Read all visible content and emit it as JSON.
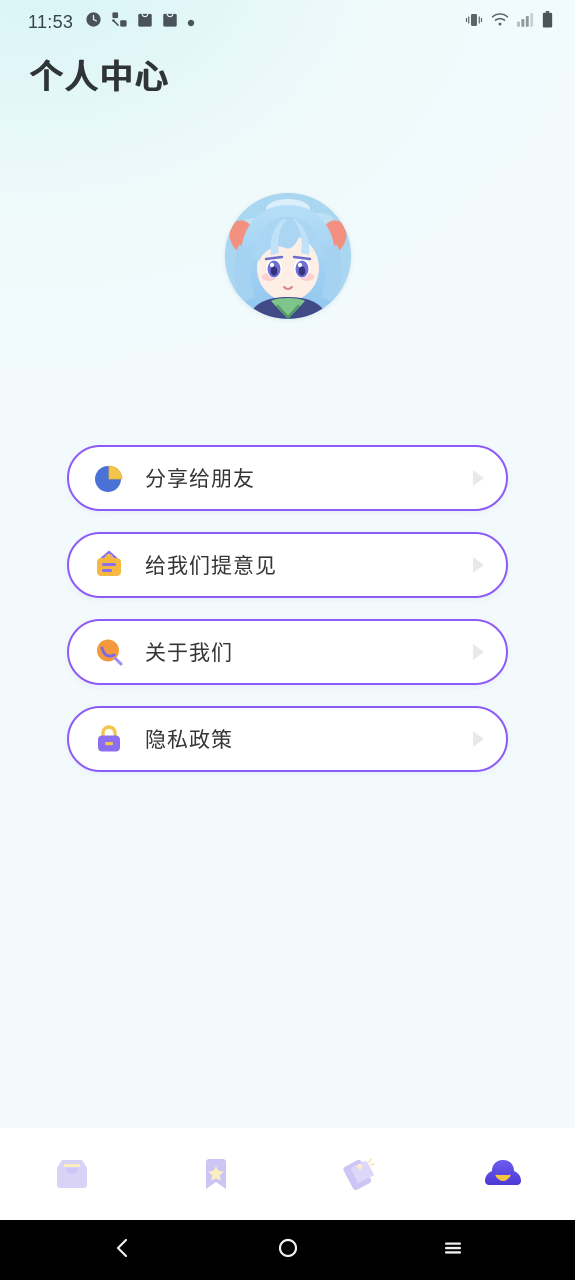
{
  "status_bar": {
    "time": "11:53",
    "left_icons": [
      "clock-alarm-icon",
      "share-network-icon",
      "shopping-bag-icon",
      "shopping-bag-icon",
      "dot-icon"
    ],
    "right_icons": [
      "vibrate-icon",
      "wifi-icon",
      "signal-icon",
      "battery-icon"
    ]
  },
  "header": {
    "title": "个人中心"
  },
  "profile": {
    "avatar_alt": "anime-girl-avatar"
  },
  "menu": {
    "items": [
      {
        "label": "分享给朋友",
        "icon": "pie-share-icon",
        "arrow": "chevron-right-icon"
      },
      {
        "label": "给我们提意见",
        "icon": "feedback-clipboard-icon",
        "arrow": "chevron-right-icon"
      },
      {
        "label": "关于我们",
        "icon": "magnifier-about-icon",
        "arrow": "chevron-right-icon"
      },
      {
        "label": "隐私政策",
        "icon": "lock-privacy-icon",
        "arrow": "chevron-right-icon"
      }
    ]
  },
  "tabbar": {
    "items": [
      {
        "name": "tab-inbox",
        "icon": "inbox-icon",
        "active": false
      },
      {
        "name": "tab-favorites",
        "icon": "bookmark-star-icon",
        "active": false
      },
      {
        "name": "tab-tags",
        "icon": "price-tag-icon",
        "active": false
      },
      {
        "name": "tab-profile",
        "icon": "cloud-person-icon",
        "active": true
      }
    ]
  },
  "navbar": {
    "buttons": [
      {
        "name": "android-back-button",
        "icon": "chevron-left-icon"
      },
      {
        "name": "android-home-button",
        "icon": "circle-icon"
      },
      {
        "name": "android-recents-button",
        "icon": "hamburger-icon"
      }
    ]
  },
  "colors": {
    "accent_purple": "#8b5cf6",
    "card_white": "#ffffff",
    "bg_cyan": "#e2f6f8",
    "text_dark": "#333537",
    "tab_inactive": "#cfc7f2",
    "tab_active": "#5b4ae0",
    "tab_accent_yellow": "#f7d358"
  }
}
